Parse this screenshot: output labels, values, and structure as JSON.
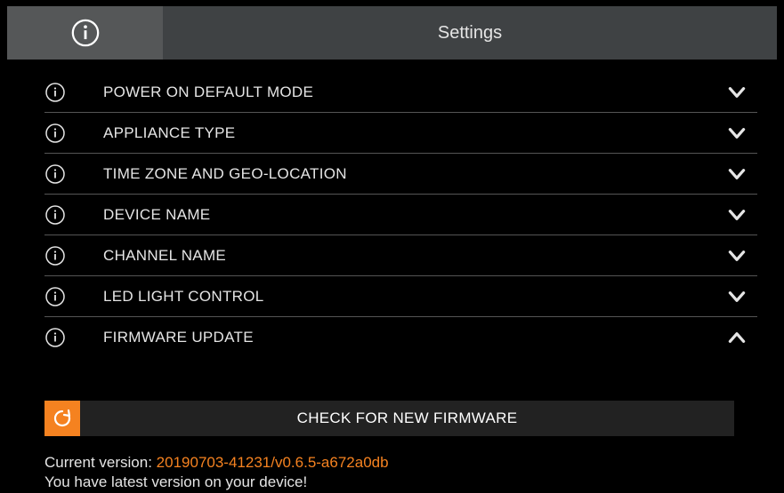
{
  "header": {
    "title": "Settings"
  },
  "rows": [
    {
      "label": "POWER ON DEFAULT MODE",
      "expanded": false
    },
    {
      "label": "APPLIANCE TYPE",
      "expanded": false
    },
    {
      "label": "TIME ZONE AND GEO-LOCATION",
      "expanded": false
    },
    {
      "label": "DEVICE NAME",
      "expanded": false
    },
    {
      "label": "CHANNEL NAME",
      "expanded": false
    },
    {
      "label": "LED LIGHT CONTROL",
      "expanded": false
    },
    {
      "label": "FIRMWARE UPDATE",
      "expanded": true
    }
  ],
  "firmware": {
    "button_label": "CHECK FOR NEW FIRMWARE",
    "current_version_label": "Current version: ",
    "current_version_value": "20190703-41231/v0.6.5-a672a0db",
    "status_message": "You have latest version on your device!"
  },
  "icons": {
    "info": "info-icon",
    "chevron_down": "chevron-down-icon",
    "chevron_up": "chevron-up-icon",
    "refresh": "refresh-icon"
  }
}
